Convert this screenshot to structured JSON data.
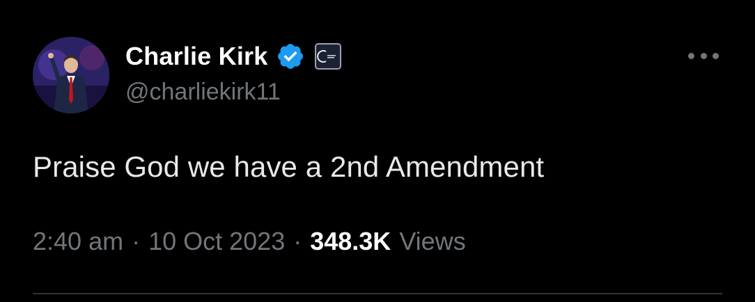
{
  "author": {
    "display_name": "Charlie Kirk",
    "handle": "@charliekirk11",
    "verified": true,
    "verified_badge_color": "#1d9bf0",
    "affiliate_badge_icon": "organization-logo-icon"
  },
  "tweet": {
    "text": "Praise God we have a 2nd Amendment",
    "time": "2:40 am",
    "date": "10 Oct 2023",
    "separator": "·",
    "views_count": "348.3K",
    "views_label": "Views"
  },
  "menu": {
    "icon": "more-options-icon"
  },
  "colors": {
    "background": "#000000",
    "primary_text": "#e7e9ea",
    "secondary_text": "#71767b",
    "divider": "#2f3336"
  }
}
